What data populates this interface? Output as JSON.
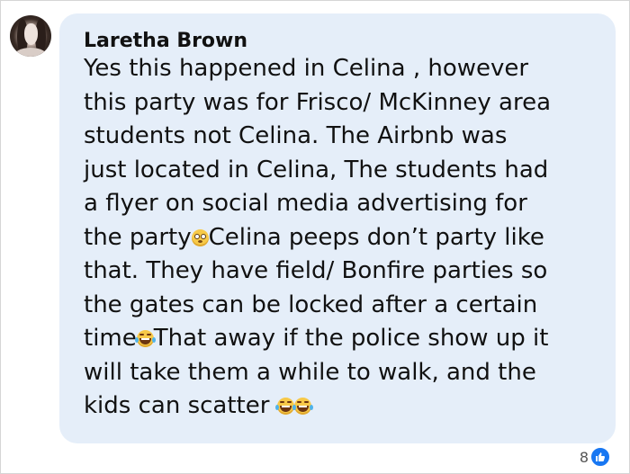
{
  "comment": {
    "author": "Laretha Brown",
    "lines": {
      "l1": "Yes this happened in Celina , however",
      "l2": "this party was for Frisco/ McKinney area",
      "l3": "students not Celina. The Airbnb was",
      "l4": "just located in Celina, The students had",
      "l5": "a flyer on social media advertising for",
      "l6a": "the party",
      "l6b": "Celina peeps don’t party like",
      "l7": "that. They have field/ Bonfire parties so",
      "l8": "the gates can be locked after a certain",
      "l9a": "time",
      "l9b": "That away if the police show up it",
      "l10": "will take them a while to walk, and the",
      "l11": "kids can scatter "
    }
  },
  "reactions": {
    "count": "8",
    "type": "like"
  },
  "icons": {
    "avatar": "profile-photo",
    "inline_emoji_1": "flushed-face",
    "inline_emoji_2": "laughing-tears-face",
    "reaction": "thumbs-up"
  },
  "colors": {
    "bubble": "#e5eef9",
    "like_blue": "#1877f2"
  }
}
